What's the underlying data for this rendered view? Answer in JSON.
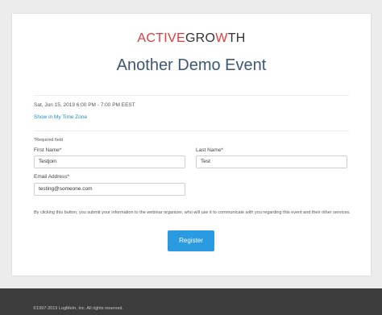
{
  "logo": {
    "part1": "ACTIVE",
    "part2": "GRO",
    "part3": "W",
    "part4": "TH"
  },
  "event": {
    "title": "Another Demo Event",
    "datetime": "Sat, Jun 15, 2019 6:00 PM - 7:00 PM EEST",
    "timezone_link": "Show in My Time Zone"
  },
  "form": {
    "required_note": "*Required field",
    "first_name": {
      "label": "First Name*",
      "value": "Testjoin"
    },
    "last_name": {
      "label": "Last Name*",
      "value": "Test"
    },
    "email": {
      "label": "Email Address*",
      "value": "testing@someone.com"
    },
    "consent": "By clicking this button, you submit your information to the webinar organizer, who will use it to communicate with you regarding this event and their other services.",
    "register_label": "Register"
  },
  "footer": {
    "copyright": "©1997-2019 LogMeIn, Inc. All rights reserved."
  },
  "colors": {
    "accent": "#2a9be0",
    "logo_red": "#e03a3e",
    "title": "#3b5879",
    "footer_bg": "#3c3c3c"
  }
}
